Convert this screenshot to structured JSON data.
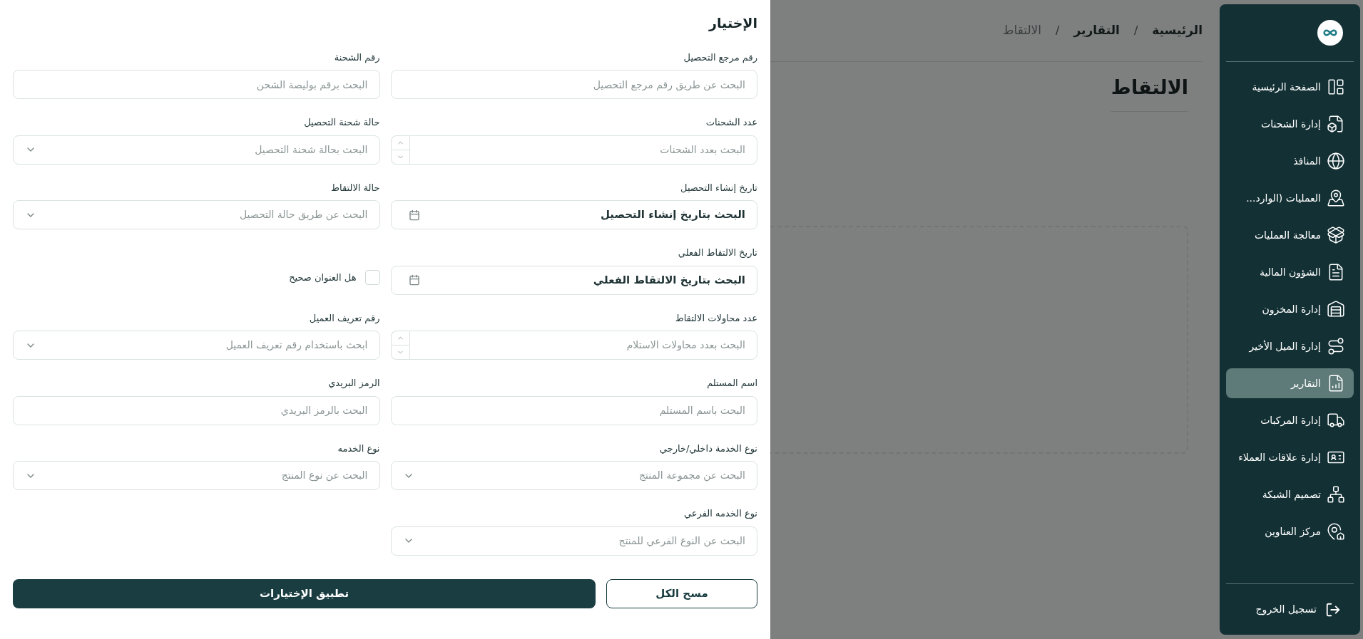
{
  "filter_panel": {
    "title": "الإختيار",
    "fields": [
      {
        "kind": "text",
        "label": "رقم مرجع التحصيل",
        "placeholder": "البحث عن طريق رقم مرجع التحصيل"
      },
      {
        "kind": "text",
        "label": "رقم الشحنة",
        "placeholder": "البحث برقم بوليصة الشحن"
      },
      {
        "kind": "number",
        "label": "عدد الشحنات",
        "placeholder": "البحث بعدد الشحنات"
      },
      {
        "kind": "select",
        "label": "حالة شحنة التحصيل",
        "placeholder": "البحث بحالة شحنة التحصيل"
      },
      {
        "kind": "date",
        "label": "تاريخ إنشاء التحصيل",
        "placeholder": "البحث بتاريخ إنشاء التحصيل"
      },
      {
        "kind": "select",
        "label": "حالة الالتقاط",
        "placeholder": "البحث عن طريق حالة التحصيل"
      },
      {
        "kind": "date",
        "label": "تاريخ الالتقاط الفعلي",
        "placeholder": "البحث بتاريخ الالتقاط الفعلي"
      },
      {
        "kind": "checkbox",
        "label": "هل العنوان صحيح",
        "checked": false
      },
      {
        "kind": "number",
        "label": "عدد محاولات الالتقاط",
        "placeholder": "البحث بعدد محاولات الاستلام"
      },
      {
        "kind": "select",
        "label": "رقم تعريف العميل",
        "placeholder": "ابحث باستخدام رقم تعريف العميل"
      },
      {
        "kind": "text",
        "label": "اسم المستلم",
        "placeholder": "البحث باسم المستلم"
      },
      {
        "kind": "text",
        "label": "الرمز البريدي",
        "placeholder": "البحث بالرمز البريدي"
      },
      {
        "kind": "select",
        "label": "نوع الخدمة داخلي/خارجي",
        "placeholder": "البحث عن مجموعة المنتج"
      },
      {
        "kind": "select",
        "label": "نوع الخدمه",
        "placeholder": "البحث عن نوع المنتج"
      },
      {
        "kind": "select",
        "label": "نوع الخدمه الفرعي",
        "placeholder": "البحث عن النوع الفرعي للمنتج"
      }
    ],
    "buttons": {
      "clear": "مسح الكل",
      "apply": "تطبيق الإختيارات"
    }
  },
  "breadcrumb_separator": "/",
  "breadcrumb": [
    {
      "label": "الرئيسية",
      "current": false
    },
    {
      "label": "التقارير",
      "current": false
    },
    {
      "label": "الالتقاط",
      "current": true
    }
  ],
  "page_title": "الالتقاط",
  "sidebar": {
    "items": [
      {
        "label": "الصفحة الرئيسية",
        "selected": false
      },
      {
        "label": "إدارة الشحنات",
        "selected": false
      },
      {
        "label": "المنافذ",
        "selected": false
      },
      {
        "label": "العمليات (الوارد...",
        "selected": false
      },
      {
        "label": "معالجة العمليات",
        "selected": false
      },
      {
        "label": "الشؤون المالية",
        "selected": false
      },
      {
        "label": "إدارة المخزون",
        "selected": false
      },
      {
        "label": "إدارة الميل الأخير",
        "selected": false
      },
      {
        "label": "التقارير",
        "selected": true
      },
      {
        "label": "إدارة المركبات",
        "selected": false
      },
      {
        "label": "إدارة علاقات العملاء",
        "selected": false
      },
      {
        "label": "تصميم الشبكة",
        "selected": false
      },
      {
        "label": "مركز العناوين",
        "selected": false
      }
    ],
    "logout": "تسجيل الخروج"
  }
}
